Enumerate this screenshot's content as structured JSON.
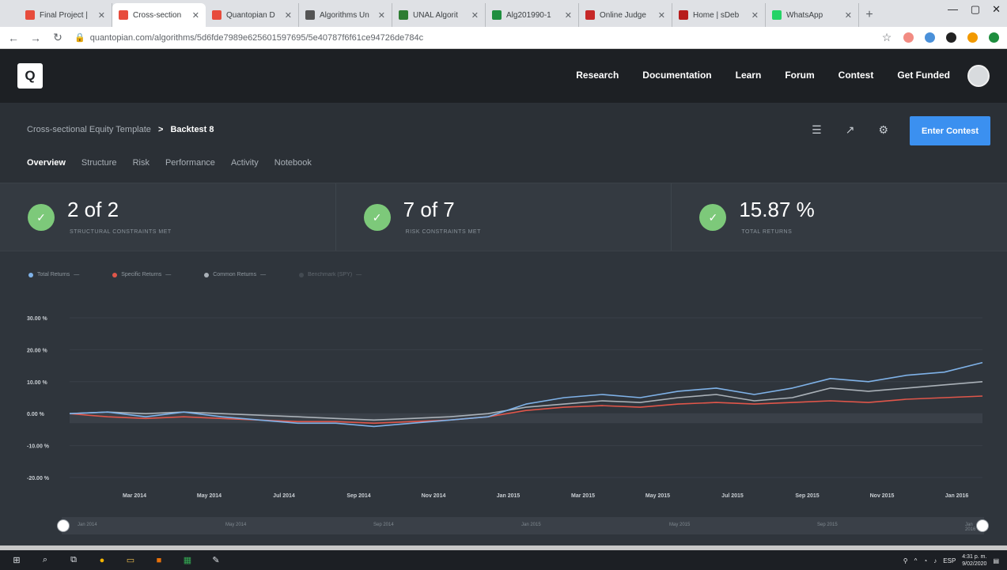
{
  "browser": {
    "tabs": [
      {
        "title": "Final Project |",
        "color": "#e74c3c",
        "active": false
      },
      {
        "title": "Cross-section",
        "color": "#e74c3c",
        "active": true
      },
      {
        "title": "Quantopian D",
        "color": "#e74c3c",
        "active": false
      },
      {
        "title": "Algorithms Un",
        "color": "#555555",
        "active": false
      },
      {
        "title": "UNAL Algorit",
        "color": "#2e7d32",
        "active": false
      },
      {
        "title": "Alg201990-1",
        "color": "#1e8e3e",
        "active": false
      },
      {
        "title": "Online Judge",
        "color": "#c62828",
        "active": false
      },
      {
        "title": "Home | sDeb",
        "color": "#b71c1c",
        "active": false
      },
      {
        "title": "WhatsApp",
        "color": "#25d366",
        "active": false
      }
    ],
    "url": "quantopian.com/algorithms/5d6fde7989e625601597695/5e40787f6f61ce94726de784c"
  },
  "header": {
    "logo": "Q",
    "nav": [
      "Research",
      "Documentation",
      "Learn",
      "Forum",
      "Contest",
      "Get Funded"
    ]
  },
  "subheader": {
    "breadcrumb_parent": "Cross-sectional Equity Template",
    "breadcrumb_sep": ">",
    "breadcrumb_current": "Backtest 8",
    "tabs": [
      "Overview",
      "Structure",
      "Risk",
      "Performance",
      "Activity",
      "Notebook"
    ],
    "active_tab": "Overview",
    "enter_button": "Enter Contest"
  },
  "metrics": [
    {
      "value": "2 of 2",
      "label": "STRUCTURAL CONSTRAINTS MET"
    },
    {
      "value": "7 of 7",
      "label": "RISK CONSTRAINTS MET"
    },
    {
      "value": "15.87 %",
      "label": "TOTAL RETURNS"
    }
  ],
  "legend": [
    {
      "name": "Total Returns",
      "color": "#7fb2e8"
    },
    {
      "name": "Specific Returns",
      "color": "#e0564a"
    },
    {
      "name": "Common Returns",
      "color": "#aab1b8"
    },
    {
      "name": "Benchmark (SPY)",
      "color": "#5a6169"
    }
  ],
  "chart_data": {
    "type": "line",
    "ylabels": [
      "30.00 %",
      "20.00 %",
      "10.00 %",
      "0.00 %",
      "-10.00 %",
      "-20.00 %"
    ],
    "ylim": [
      -20,
      30
    ],
    "xlabels": [
      "Mar 2014",
      "May 2014",
      "Jul 2014",
      "Sep 2014",
      "Nov 2014",
      "Jan 2015",
      "Mar 2015",
      "May 2015",
      "Jul 2015",
      "Sep 2015",
      "Nov 2015",
      "Jan 2016"
    ],
    "x": [
      0,
      1,
      2,
      3,
      4,
      5,
      6,
      7,
      8,
      9,
      10,
      11,
      12,
      13,
      14,
      15,
      16,
      17,
      18,
      19,
      20,
      21,
      22,
      23,
      24
    ],
    "series": [
      {
        "name": "Total Returns",
        "color": "#7fb2e8",
        "values": [
          0,
          0.5,
          -1,
          0.5,
          -1,
          -2,
          -3,
          -3,
          -4,
          -3,
          -2,
          -1,
          3,
          5,
          6,
          5,
          7,
          8,
          6,
          8,
          11,
          10,
          12,
          13,
          16
        ]
      },
      {
        "name": "Specific Returns",
        "color": "#e0564a",
        "values": [
          0,
          -1,
          -1.5,
          -1,
          -1.5,
          -2,
          -2.5,
          -2.5,
          -3,
          -2.5,
          -2,
          -1,
          1,
          2,
          2.5,
          2,
          3,
          3.5,
          3,
          3.5,
          4,
          3.5,
          4.5,
          5,
          5.5
        ]
      },
      {
        "name": "Common Returns",
        "color": "#aab1b8",
        "values": [
          0,
          0.5,
          0,
          0.5,
          0,
          -0.5,
          -1,
          -1.5,
          -2,
          -1.5,
          -1,
          0,
          2,
          3,
          4,
          3.5,
          5,
          6,
          4,
          5,
          8,
          7,
          8,
          9,
          10
        ]
      }
    ]
  },
  "navigator": {
    "labels": [
      "Jan 2014",
      "May 2014",
      "Sep 2014",
      "Jan 2015",
      "May 2015",
      "Sep 2015",
      "Jan 2016"
    ]
  },
  "taskbar": {
    "lang": "ESP",
    "time": "4:31 p. m.",
    "date": "9/02/2020"
  }
}
